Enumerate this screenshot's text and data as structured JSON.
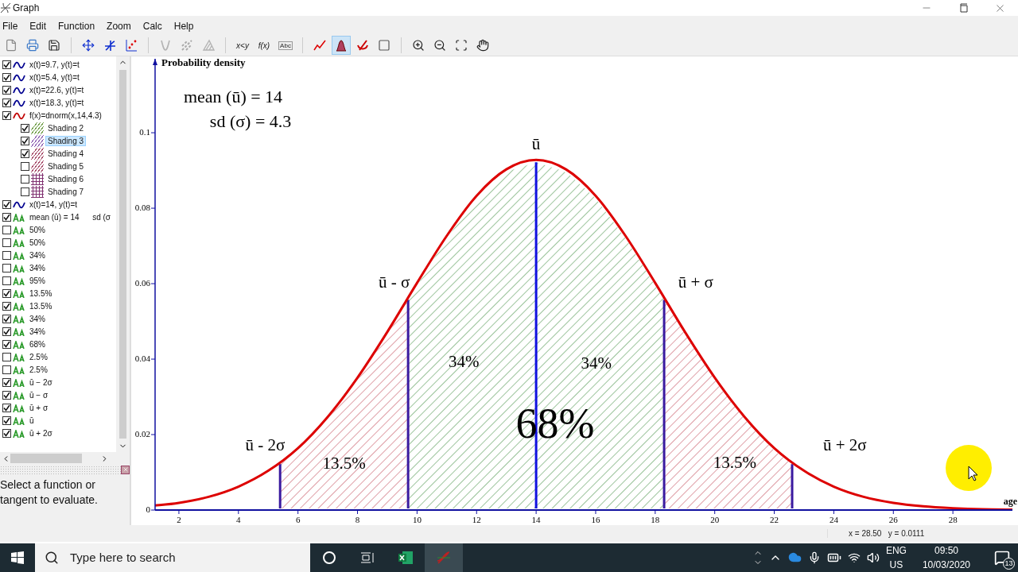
{
  "window": {
    "title": "Graph"
  },
  "menu": [
    "File",
    "Edit",
    "Function",
    "Zoom",
    "Calc",
    "Help"
  ],
  "toolbar": [
    {
      "kind": "new",
      "selected": false,
      "disabled": false
    },
    {
      "kind": "print",
      "selected": false,
      "disabled": false
    },
    {
      "kind": "save",
      "selected": false,
      "disabled": false
    },
    {
      "kind": "sep"
    },
    {
      "kind": "axes",
      "selected": false,
      "disabled": false
    },
    {
      "kind": "function",
      "selected": false,
      "disabled": false
    },
    {
      "kind": "points",
      "selected": false,
      "disabled": false
    },
    {
      "kind": "sep"
    },
    {
      "kind": "tangent",
      "selected": false,
      "disabled": true
    },
    {
      "kind": "relation",
      "selected": false,
      "disabled": true
    },
    {
      "kind": "hatch",
      "selected": false,
      "disabled": true
    },
    {
      "kind": "sep"
    },
    {
      "kind": "text",
      "text": "x<y",
      "selected": false,
      "disabled": false
    },
    {
      "kind": "text",
      "text": "f(x)",
      "selected": false,
      "disabled": false
    },
    {
      "kind": "label",
      "text": "Abc",
      "selected": false,
      "disabled": false
    },
    {
      "kind": "sep"
    },
    {
      "kind": "curve",
      "selected": false,
      "disabled": false
    },
    {
      "kind": "shade",
      "selected": true,
      "disabled": false
    },
    {
      "kind": "series",
      "selected": false,
      "disabled": false
    },
    {
      "kind": "window",
      "selected": false,
      "disabled": false
    },
    {
      "kind": "sep"
    },
    {
      "kind": "zoom-in",
      "selected": false,
      "disabled": false
    },
    {
      "kind": "zoom-out",
      "selected": false,
      "disabled": false
    },
    {
      "kind": "zoom-fit",
      "selected": false,
      "disabled": false
    },
    {
      "kind": "hand",
      "selected": false,
      "disabled": false
    }
  ],
  "sidebar": {
    "items": [
      {
        "kind": "curve",
        "label": "x(t)=9.7, y(t)=t",
        "checked": true,
        "selected": false,
        "color": "#000090"
      },
      {
        "kind": "curve",
        "label": "x(t)=5.4, y(t)=t",
        "checked": true,
        "selected": false,
        "color": "#000090"
      },
      {
        "kind": "curve",
        "label": "x(t)=22.6, y(t)=t",
        "checked": true,
        "selected": false,
        "color": "#000090"
      },
      {
        "kind": "curve",
        "label": "x(t)=18.3, y(t)=t",
        "checked": true,
        "selected": false,
        "color": "#000090"
      },
      {
        "kind": "curve",
        "label": "f(x)=dnorm(x,14,4.3)",
        "checked": true,
        "selected": false,
        "color": "#c00000",
        "children": [
          {
            "kind": "hatch",
            "label": "Shading 2",
            "checked": true,
            "selected": false,
            "color": "#6a9a40"
          },
          {
            "kind": "hatch",
            "label": "Shading 3",
            "checked": true,
            "selected": true,
            "color": "#8a5ab0"
          },
          {
            "kind": "hatch",
            "label": "Shading 4",
            "checked": true,
            "selected": false,
            "color": "#a04060"
          },
          {
            "kind": "hatch",
            "label": "Shading 5",
            "checked": false,
            "selected": false,
            "color": "#a04060"
          },
          {
            "kind": "grid",
            "label": "Shading 6",
            "checked": false,
            "selected": false,
            "color": "#803070"
          },
          {
            "kind": "grid",
            "label": "Shading 7",
            "checked": false,
            "selected": false,
            "color": "#803070"
          }
        ]
      },
      {
        "kind": "curve",
        "label": "x(t)=14, y(t)=t",
        "checked": true,
        "selected": false,
        "color": "#000090"
      },
      {
        "kind": "label",
        "label": "mean (ū) = 14      sd (σ",
        "checked": true,
        "selected": false
      },
      {
        "kind": "label",
        "label": "50%",
        "checked": false,
        "selected": false
      },
      {
        "kind": "label",
        "label": "50%",
        "checked": false,
        "selected": false
      },
      {
        "kind": "label",
        "label": "34%",
        "checked": false,
        "selected": false
      },
      {
        "kind": "label",
        "label": "34%",
        "checked": false,
        "selected": false
      },
      {
        "kind": "label",
        "label": "95%",
        "checked": false,
        "selected": false
      },
      {
        "kind": "label",
        "label": "13.5%",
        "checked": true,
        "selected": false
      },
      {
        "kind": "label",
        "label": "13.5%",
        "checked": true,
        "selected": false
      },
      {
        "kind": "label",
        "label": "34%",
        "checked": true,
        "selected": false
      },
      {
        "kind": "label",
        "label": "34%",
        "checked": true,
        "selected": false
      },
      {
        "kind": "label",
        "label": "68%",
        "checked": true,
        "selected": false
      },
      {
        "kind": "label",
        "label": "2.5%",
        "checked": false,
        "selected": false
      },
      {
        "kind": "label",
        "label": "2.5%",
        "checked": false,
        "selected": false
      },
      {
        "kind": "label",
        "label": "ū − 2σ",
        "checked": true,
        "selected": false
      },
      {
        "kind": "label",
        "label": "ū − σ",
        "checked": true,
        "selected": false
      },
      {
        "kind": "label",
        "label": "ū + σ",
        "checked": true,
        "selected": false
      },
      {
        "kind": "label",
        "label": "ū",
        "checked": true,
        "selected": false
      },
      {
        "kind": "label",
        "label": "ū + 2σ",
        "checked": true,
        "selected": false
      }
    ]
  },
  "evaluate_panel": {
    "message": "Select a function or tangent to evaluate."
  },
  "graph": {
    "chart_data": {
      "type": "line",
      "ylabel": "Probability density",
      "xlabel": "age",
      "x": [
        1.2,
        2,
        3,
        4,
        5,
        6,
        7,
        8,
        9,
        10,
        11,
        12,
        13,
        14,
        15,
        16,
        17,
        18,
        19,
        20,
        21,
        22,
        23,
        24,
        25,
        26,
        27,
        28,
        29,
        30
      ],
      "series": [
        {
          "color": "#dd0000",
          "values": [
            0.0012,
            0.0019,
            0.0035,
            0.0062,
            0.0104,
            0.0164,
            0.0247,
            0.0351,
            0.0472,
            0.0602,
            0.0727,
            0.0833,
            0.0903,
            0.0928,
            0.0903,
            0.0833,
            0.0727,
            0.0602,
            0.0472,
            0.0351,
            0.0247,
            0.0164,
            0.0104,
            0.0062,
            0.0035,
            0.0019,
            0.001,
            0.0005,
            0.0002,
            0.0001
          ]
        }
      ],
      "xlim": [
        1.2,
        30
      ],
      "ylim": [
        0,
        0.1196
      ],
      "xticks": [
        2,
        4,
        6,
        8,
        10,
        12,
        14,
        16,
        18,
        20,
        22,
        24,
        26,
        28
      ],
      "yticks": [
        0,
        0.02,
        0.04,
        0.06,
        0.08,
        {
          "value": 0.1,
          "label": "0.1"
        }
      ],
      "annotations": [
        "mean (ū) = 14",
        "sd (σ) = 4.3",
        "ū",
        "ū - σ",
        "ū + σ",
        "34%",
        "34%",
        "68%",
        "ū - 2σ",
        "ū + 2σ",
        "13.5%",
        "13.5%"
      ]
    }
  },
  "status_bar": {
    "coordinates": "x = 28.50   y = 0.0111"
  },
  "taskbar": {
    "search": {
      "placeholder": "Type here to search"
    },
    "language": "ENG",
    "region": "US",
    "time": "09:50",
    "date": "10/03/2020",
    "notifications": "13"
  }
}
